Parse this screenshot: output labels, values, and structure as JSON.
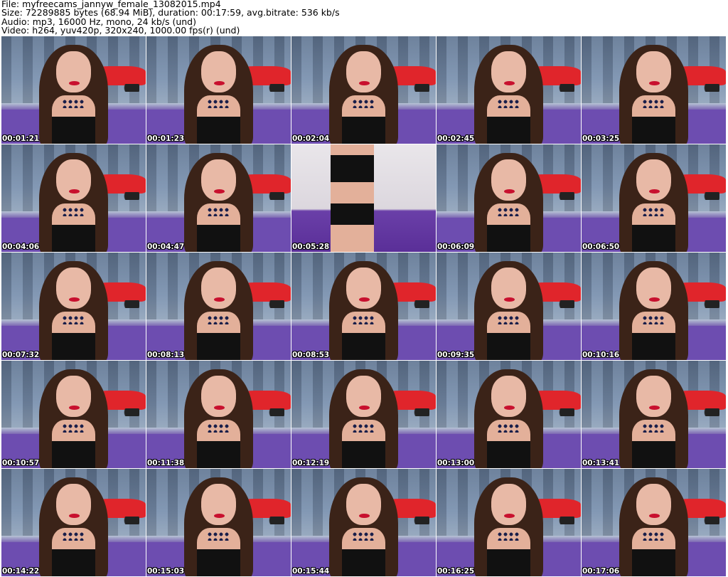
{
  "header": {
    "file": "File: myfreecams_jannyw_female_13082015.mp4",
    "size": "Size: 72289885 bytes (68.94 MiB), duration: 00:17:59, avg.bitrate: 536 kb/s",
    "audio": "Audio: mp3, 16000 Hz, mono, 24 kb/s (und)",
    "video": "Video: h264, yuv420p, 320x240, 1000.00 fps(r) (und)"
  },
  "thumbnails": [
    "00:01:21",
    "00:01:23",
    "00:02:04",
    "00:02:45",
    "00:03:25",
    "00:04:06",
    "00:04:47",
    "00:05:28",
    "00:06:09",
    "00:06:50",
    "00:07:32",
    "00:08:13",
    "00:08:53",
    "00:09:35",
    "00:10:16",
    "00:10:57",
    "00:11:38",
    "00:12:19",
    "00:13:00",
    "00:13:41",
    "00:14:22",
    "00:15:03",
    "00:15:44",
    "00:16:25",
    "00:17:06"
  ],
  "alt_frame_index": 7
}
